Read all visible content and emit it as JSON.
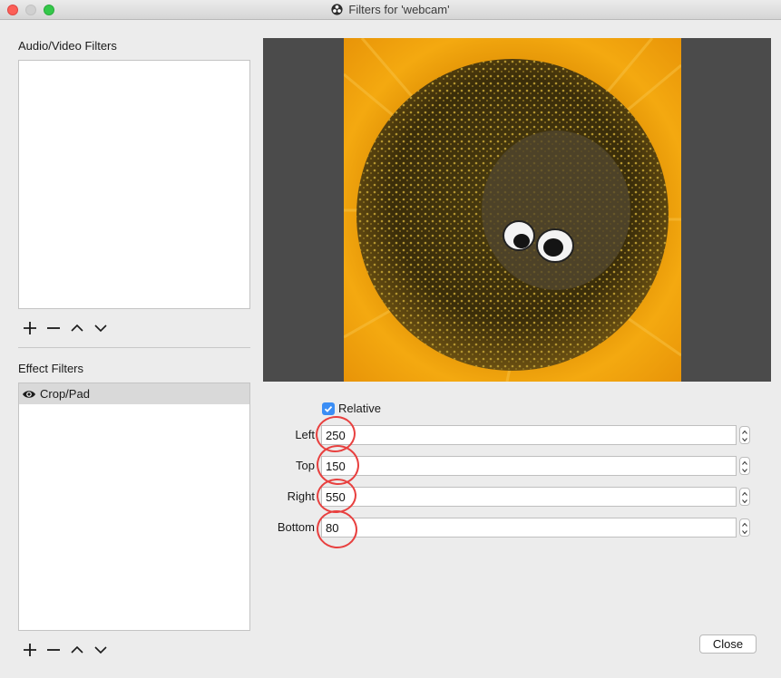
{
  "window": {
    "title": "Filters for 'webcam'"
  },
  "audio_video": {
    "label": "Audio/Video Filters",
    "items": []
  },
  "effects": {
    "label": "Effect Filters",
    "items": [
      {
        "label": "Crop/Pad",
        "selected": true
      }
    ]
  },
  "toolbar_icons": [
    "plus-icon",
    "minus-icon",
    "chevron-up-icon",
    "chevron-down-icon"
  ],
  "crop": {
    "relative_label": "Relative",
    "relative_checked": true,
    "fields": [
      {
        "label": "Left",
        "value": "250"
      },
      {
        "label": "Top",
        "value": "150"
      },
      {
        "label": "Right",
        "value": "550"
      },
      {
        "label": "Bottom",
        "value": "80"
      }
    ]
  },
  "close_label": "Close",
  "colors": {
    "checkbox": "#3b8ef5",
    "annotation_circle": "#e8403f",
    "preview_bg": "#4b4b4b"
  }
}
